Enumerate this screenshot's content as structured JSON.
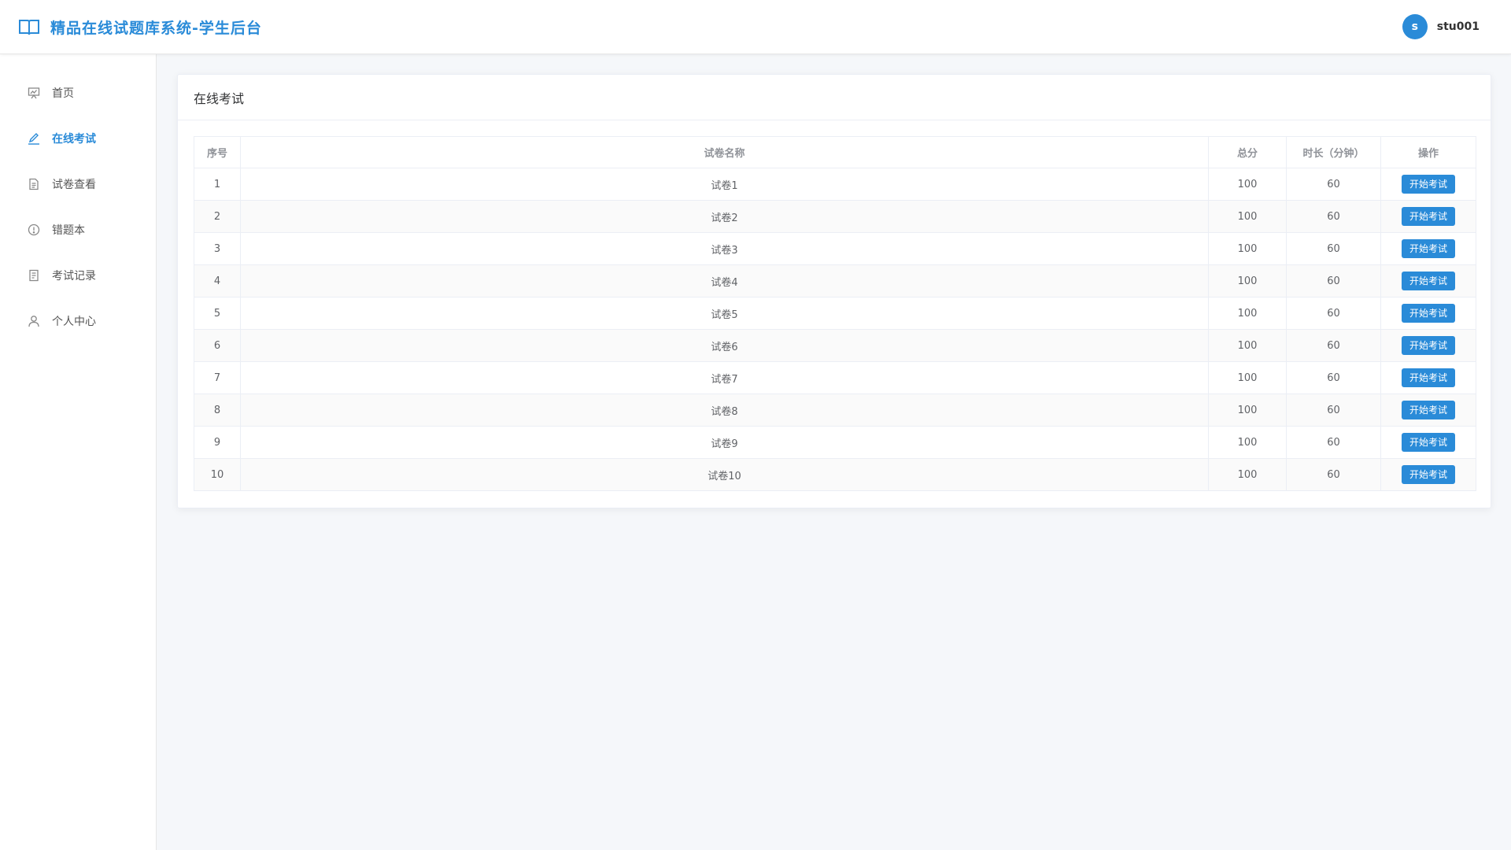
{
  "header": {
    "title": "精品在线试题库系统-学生后台",
    "avatar_letter": "s",
    "username": "stu001",
    "brand_color": "#2a8bd8"
  },
  "sidebar": {
    "items": [
      {
        "label": "首页",
        "icon": "presentation-icon",
        "active": false
      },
      {
        "label": "在线考试",
        "icon": "pen-icon",
        "active": true
      },
      {
        "label": "试卷查看",
        "icon": "document-icon",
        "active": false
      },
      {
        "label": "错题本",
        "icon": "alert-circle-icon",
        "active": false
      },
      {
        "label": "考试记录",
        "icon": "record-icon",
        "active": false
      },
      {
        "label": "个人中心",
        "icon": "user-icon",
        "active": false
      }
    ]
  },
  "main": {
    "card_title": "在线考试",
    "table": {
      "columns": [
        "序号",
        "试卷名称",
        "总分",
        "时长（分钟）",
        "操作"
      ],
      "action_label": "开始考试",
      "rows": [
        {
          "index": "1",
          "name": "试卷1",
          "score": "100",
          "duration": "60"
        },
        {
          "index": "2",
          "name": "试卷2",
          "score": "100",
          "duration": "60"
        },
        {
          "index": "3",
          "name": "试卷3",
          "score": "100",
          "duration": "60"
        },
        {
          "index": "4",
          "name": "试卷4",
          "score": "100",
          "duration": "60"
        },
        {
          "index": "5",
          "name": "试卷5",
          "score": "100",
          "duration": "60"
        },
        {
          "index": "6",
          "name": "试卷6",
          "score": "100",
          "duration": "60"
        },
        {
          "index": "7",
          "name": "试卷7",
          "score": "100",
          "duration": "60"
        },
        {
          "index": "8",
          "name": "试卷8",
          "score": "100",
          "duration": "60"
        },
        {
          "index": "9",
          "name": "试卷9",
          "score": "100",
          "duration": "60"
        },
        {
          "index": "10",
          "name": "试卷10",
          "score": "100",
          "duration": "60"
        }
      ]
    }
  }
}
